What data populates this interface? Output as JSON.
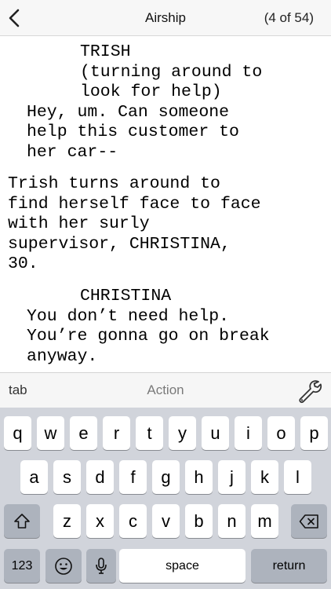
{
  "nav": {
    "title": "Airship",
    "counter": "(4 of 54)"
  },
  "script_lines": [
    "TRISH",
    "(turning around to",
    "look for help)",
    "Hey, um. Can someone",
    "help this customer to",
    "her car--",
    "Trish turns around to",
    "find herself face to face",
    "with her surly",
    "supervisor, CHRISTINA,",
    "30.",
    "CHRISTINA",
    "You don’t need help.",
    "You’re gonna go on break",
    "anyway."
  ],
  "accessory": {
    "tab_label": "tab",
    "element_type": "Action",
    "wrench_icon": "wrench-icon"
  },
  "keyboard": {
    "row1": [
      "q",
      "w",
      "e",
      "r",
      "t",
      "y",
      "u",
      "i",
      "o",
      "p"
    ],
    "row2": [
      "a",
      "s",
      "d",
      "f",
      "g",
      "h",
      "j",
      "k",
      "l"
    ],
    "row3": [
      "z",
      "x",
      "c",
      "v",
      "b",
      "n",
      "m"
    ],
    "numbers_label": "123",
    "space_label": "space",
    "return_label": "return",
    "shift_icon": "shift-icon",
    "delete_icon": "delete-icon",
    "emoji_icon": "emoji-icon",
    "mic_icon": "microphone-icon"
  }
}
